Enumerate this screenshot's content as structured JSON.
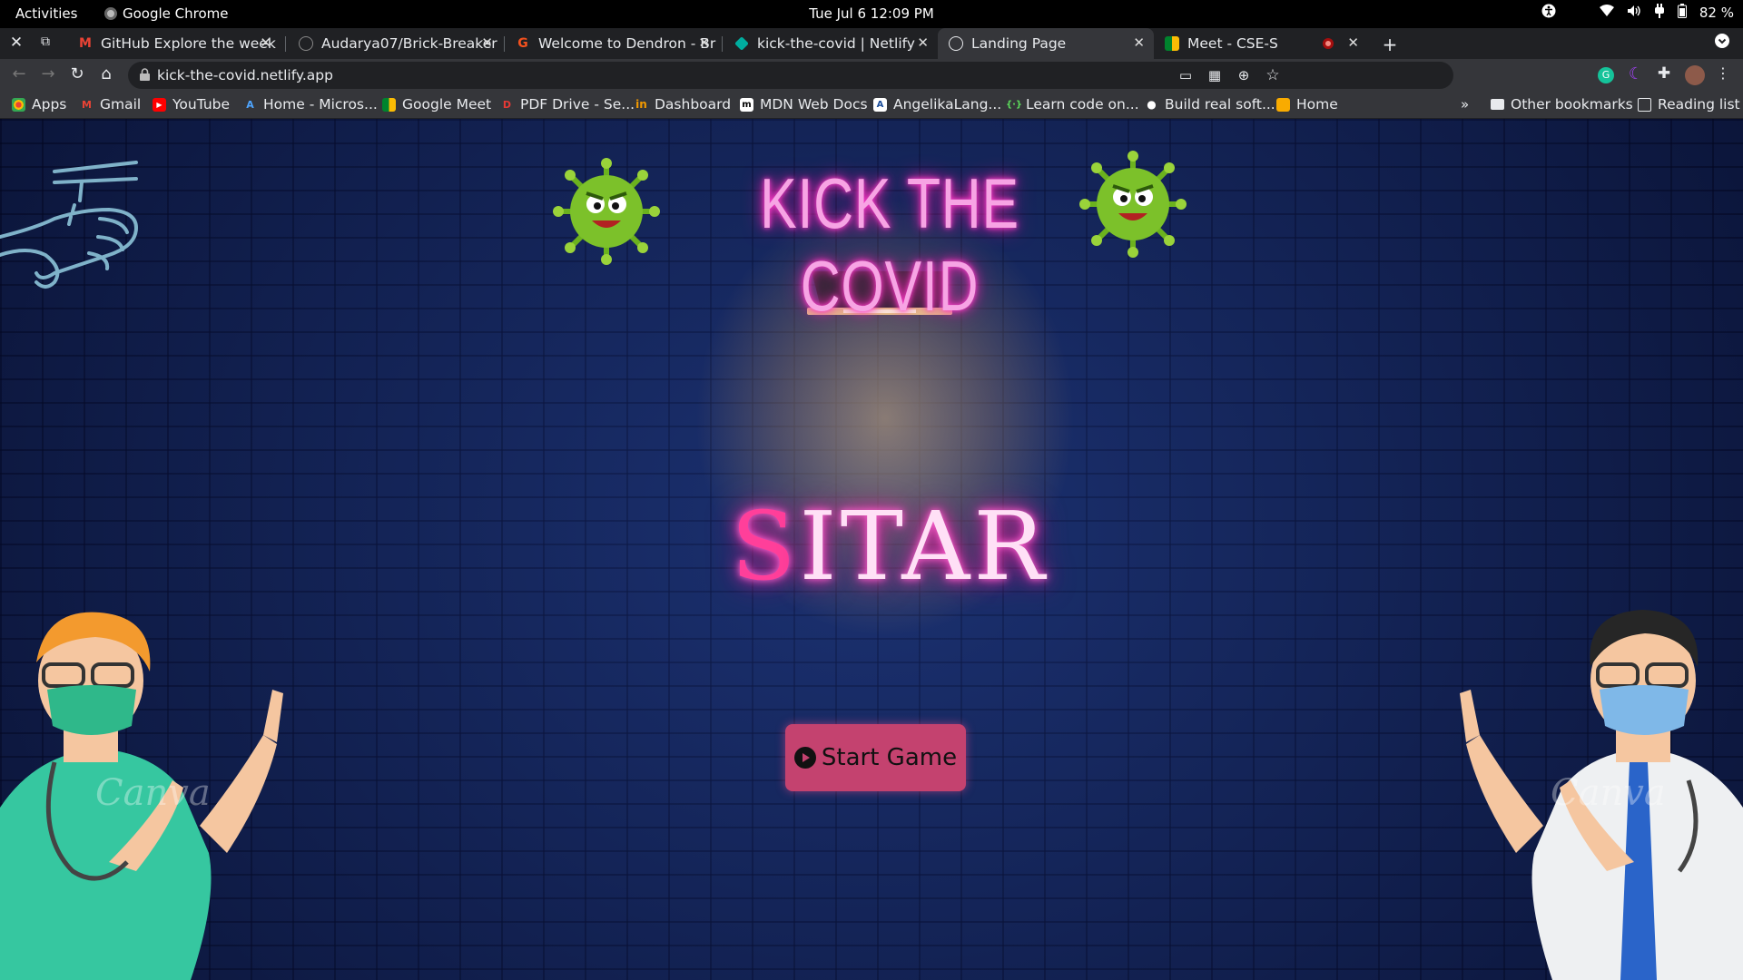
{
  "system_bar": {
    "activities": "Activities",
    "app_name": "Google Chrome",
    "clock": "Tue Jul 6  12:09 PM",
    "battery": "82 %"
  },
  "tabs": [
    {
      "label": "GitHub Explore the week c",
      "favicon": "gmail-icon",
      "active": false
    },
    {
      "label": "Audarya07/Brick-Breaker",
      "favicon": "github-icon",
      "active": false
    },
    {
      "label": "Welcome to Dendron - Br",
      "favicon": "dendron-icon",
      "active": false
    },
    {
      "label": "kick-the-covid | Netlify",
      "favicon": "netlify-icon",
      "active": false
    },
    {
      "label": "Landing Page",
      "favicon": "globe-icon",
      "active": true
    },
    {
      "label": "Meet - CSE-S",
      "favicon": "meet-icon",
      "active": false
    }
  ],
  "address_bar": {
    "url": "kick-the-covid.netlify.app"
  },
  "bookmarks": [
    {
      "label": "Apps",
      "icon": "apps-grid-icon",
      "color": "#ea4335"
    },
    {
      "label": "Gmail",
      "icon": "gmail-icon",
      "color": "#ea4335"
    },
    {
      "label": "YouTube",
      "icon": "youtube-icon",
      "color": "#ff0000"
    },
    {
      "label": "Home - Micros...",
      "icon": "azure-icon",
      "color": "#0078d4"
    },
    {
      "label": "Google Meet",
      "icon": "meet-icon",
      "color": "#00897b"
    },
    {
      "label": "PDF Drive - Se...",
      "icon": "pdf-icon",
      "color": "#c62828"
    },
    {
      "label": "Dashboard",
      "icon": "dashboard-icon",
      "color": "#f29900"
    },
    {
      "label": "MDN Web Docs",
      "icon": "mdn-icon",
      "color": "#ffffff"
    },
    {
      "label": "AngelikaLang...",
      "icon": "angelika-icon",
      "color": "#ffffff"
    },
    {
      "label": "Learn code on...",
      "icon": "code-icon",
      "color": "#34a853"
    },
    {
      "label": "Build real soft...",
      "icon": "build-icon",
      "color": "#ffffff"
    },
    {
      "label": "Home",
      "icon": "home-box-icon",
      "color": "#f9ab00"
    }
  ],
  "bookmarks_overflow": "»",
  "other_bookmarks": "Other bookmarks",
  "reading_list": "Reading list",
  "page": {
    "title": "KICK THE COVID",
    "logo_first_letter": "S",
    "logo_rest": "ITAR",
    "start_button": "Start Game",
    "watermark": "Canva"
  },
  "colors": {
    "chrome_dark": "#202124",
    "chrome_toolbar": "#35363a",
    "neon_pink": "#ff3fcf",
    "button_bg": "#c4426f",
    "virus_green": "#7cc12a"
  }
}
